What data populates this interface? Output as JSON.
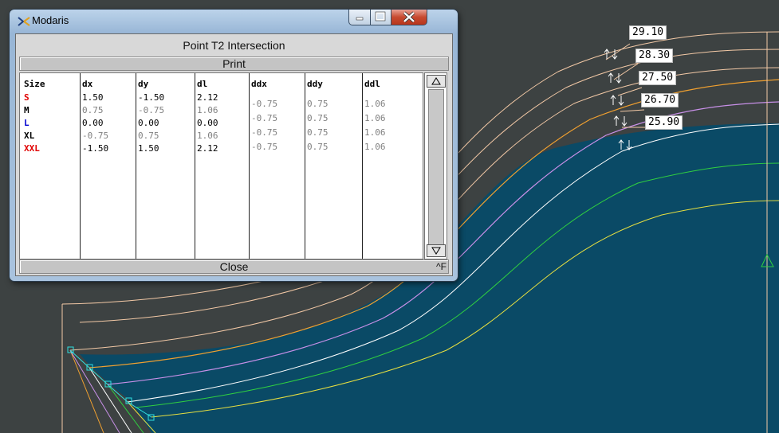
{
  "window": {
    "app_title": "Modaris",
    "dialog_title": "Point T2 Intersection",
    "print_label": "Print",
    "close_label": "Close",
    "close_shortcut": "^F"
  },
  "table": {
    "headers": [
      "Size",
      "dx",
      "dy",
      "dl",
      "ddx",
      "ddy",
      "ddl"
    ],
    "sizes": [
      {
        "label": "S",
        "color": "red"
      },
      {
        "label": "M",
        "color": "black"
      },
      {
        "label": "L",
        "color": "blue"
      },
      {
        "label": "XL",
        "color": "black"
      },
      {
        "label": "XXL",
        "color": "red"
      }
    ],
    "dx": [
      "1.50",
      "0.75",
      "0.00",
      "-0.75",
      "-1.50"
    ],
    "dy": [
      "-1.50",
      "-0.75",
      "0.00",
      "0.75",
      "1.50"
    ],
    "dl": [
      "2.12",
      "1.06",
      "0.00",
      "1.06",
      "2.12"
    ],
    "ddx": [
      "-0.75",
      "-0.75",
      "-0.75",
      "-0.75"
    ],
    "ddy": [
      "0.75",
      "0.75",
      "0.75",
      "0.75"
    ],
    "ddl": [
      "1.06",
      "1.06",
      "1.06",
      "1.06"
    ]
  },
  "measurements": [
    "29.10",
    "28.30",
    "27.50",
    "26.70",
    "25.90"
  ],
  "colors": {
    "desktop": "#3d4242",
    "pattern_fill": "#0a4a66",
    "line_peach": "#f3c9a6",
    "line_orange": "#f0a030",
    "line_violet": "#c890e8",
    "line_white": "#ffffff",
    "line_green": "#30d040",
    "line_yellow": "#e8e040",
    "point_cyan": "#30e0e0"
  }
}
